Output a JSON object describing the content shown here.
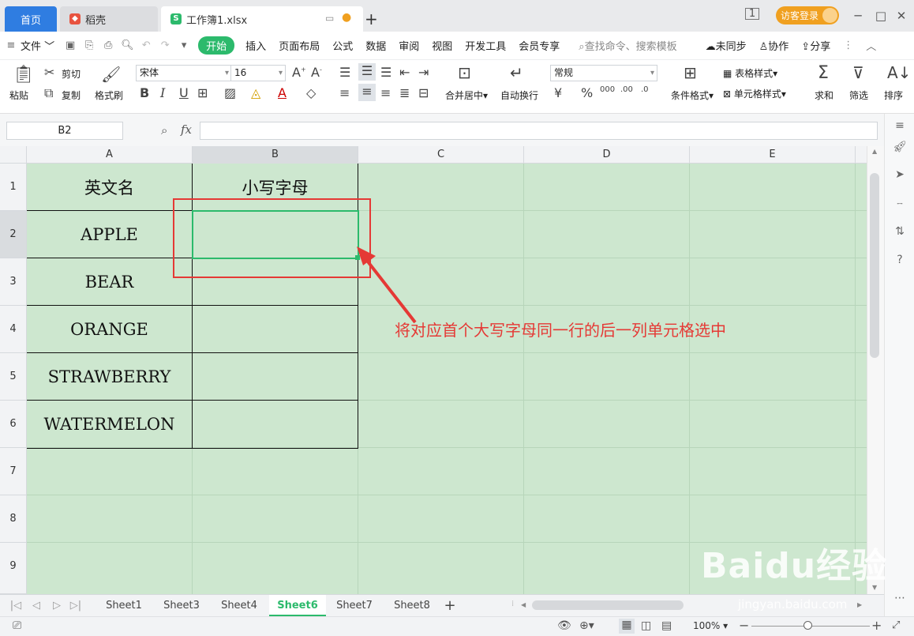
{
  "tabs": {
    "home": "首页",
    "daoke": "稻壳",
    "file": "工作簿1.xlsx",
    "add": "+"
  },
  "topright": {
    "login": "访客登录"
  },
  "menu": {
    "file": "文件",
    "items": [
      "开始",
      "插入",
      "页面布局",
      "公式",
      "数据",
      "审阅",
      "视图",
      "开发工具",
      "会员专享"
    ],
    "search": "查找命令、搜索模板",
    "sync": "未同步",
    "collab": "协作",
    "share": "分享"
  },
  "ribbon": {
    "paste": "粘贴",
    "cut": "剪切",
    "copy": "复制",
    "format_painter": "格式刷",
    "font": "宋体",
    "font_size": "16",
    "merge_center": "合并居中",
    "wrap": "自动换行",
    "number_format": "常规",
    "cond_format": "条件格式",
    "table_style": "表格样式",
    "cell_style": "单元格样式",
    "sum": "求和",
    "filter": "筛选",
    "sort": "排序"
  },
  "formula": {
    "namebox": "B2",
    "fx": "fx",
    "value": ""
  },
  "columns": [
    "A",
    "B",
    "C",
    "D",
    "E"
  ],
  "rows": [
    "1",
    "2",
    "3",
    "4",
    "5",
    "6",
    "7",
    "8",
    "9"
  ],
  "cells": {
    "A1": "英文名",
    "B1": "小写字母",
    "A2": "APPLE",
    "A3": "BEAR",
    "A4": "ORANGE",
    "A5": "STRAWBERRY",
    "A6": "WATERMELON"
  },
  "annotation": "将对应首个大写字母同一行的后一列单元格选中",
  "sheets": [
    "Sheet1",
    "Sheet3",
    "Sheet4",
    "Sheet6",
    "Sheet7",
    "Sheet8"
  ],
  "active_sheet": "Sheet6",
  "status": {
    "zoom": "100%"
  },
  "watermark": {
    "main": "Baidu经验",
    "sub": "jingyan.baidu.com"
  },
  "colors": {
    "sheet_bg": "#cde7cf",
    "accent_green": "#2cba6c",
    "annotation_red": "#e53935",
    "home_tab_blue": "#2f7de1"
  }
}
